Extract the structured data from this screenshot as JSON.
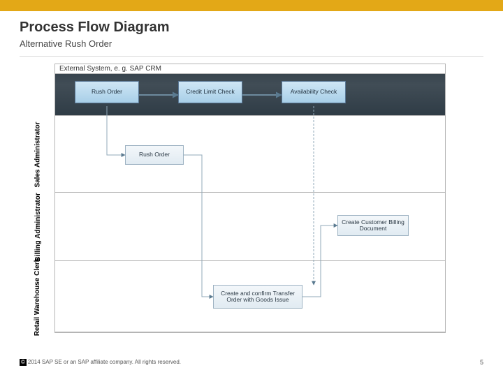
{
  "header": {
    "title": "Process Flow Diagram",
    "subtitle": "Alternative Rush Order"
  },
  "lanes": {
    "external": {
      "title": "External System, e. g. SAP CRM"
    },
    "sales": {
      "role": "Sales Administrator"
    },
    "billing": {
      "role": "Billing Administrator"
    },
    "retail": {
      "role": "Retail Warehouse Clerk"
    }
  },
  "steps": {
    "ext_rush": "Rush Order",
    "ext_credit": "Credit Limit Check",
    "ext_avail": "Availability Check",
    "sales_rush": "Rush Order",
    "billing_doc": "Create Customer Billing Document",
    "transfer": "Create and confirm Transfer Order with Goods Issue"
  },
  "footer": {
    "copyright": "2014 SAP SE or an SAP affiliate company. All rights reserved.",
    "copy_symbol": "©",
    "page": "5"
  }
}
